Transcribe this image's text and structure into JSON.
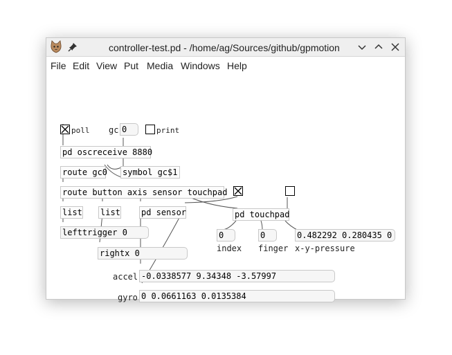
{
  "window": {
    "title": "controller-test.pd - /home/ag/Sources/github/gpmotion"
  },
  "menu": [
    "File",
    "Edit",
    "View",
    "Put",
    "Media",
    "Windows",
    "Help"
  ],
  "canvas": {
    "toggles": {
      "poll_label": "poll",
      "print_label": "print"
    },
    "gc_label": "gc",
    "gc_value": "0",
    "objects": {
      "oscreceive": "pd oscreceive 8880",
      "route_gc0": "route gc0",
      "symbol_gc": "symbol gc$1",
      "route_main": "route button axis sensor touchpad",
      "list1": "list",
      "list2": "list",
      "pd_sensor": "pd sensor",
      "pd_touchpad": "pd touchpad"
    },
    "numbers": {
      "lefttrigger": "lefttrigger 0",
      "rightx": "rightx 0",
      "index": "0",
      "finger": "0"
    },
    "lists": {
      "xyp_value": "0.482292 0.280435 0",
      "accel_label": "accel",
      "accel_value": "-0.0338577 9.34348 -3.57997",
      "gyro_label": "gyro",
      "gyro_value": "0 0.0661163 0.0135384"
    },
    "labels": {
      "index": "index",
      "finger": "finger",
      "xyp": "x-y-pressure"
    }
  }
}
